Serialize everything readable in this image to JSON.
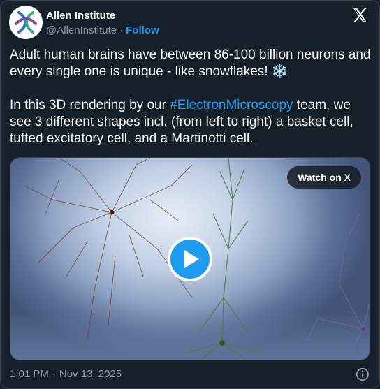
{
  "author": {
    "name": "Allen Institute",
    "handle": "@AllenInstitute",
    "separator": "·",
    "follow_label": "Follow"
  },
  "tweet": {
    "line1": "Adult human brains have between 86-100 billion neurons and every single one is unique - like snowflakes! ❄️",
    "line2_before": "In this 3D rendering by our ",
    "hashtag": "#ElectronMicroscopy",
    "line2_after": " team, we see 3 different shapes incl. (from left to right) a basket cell, tufted excitatory cell, and a Martinotti cell."
  },
  "media": {
    "watch_label": "Watch on X"
  },
  "footer": {
    "time": "1:01 PM",
    "separator": "·",
    "date": "Nov 13, 2025"
  },
  "icons": {
    "brand": "x-logo-icon",
    "play": "play-icon",
    "info": "info-icon"
  },
  "colors": {
    "background": "#15202b",
    "accent": "#1d9bf0",
    "text": "#f7f9f9",
    "muted": "#8b98a5"
  }
}
